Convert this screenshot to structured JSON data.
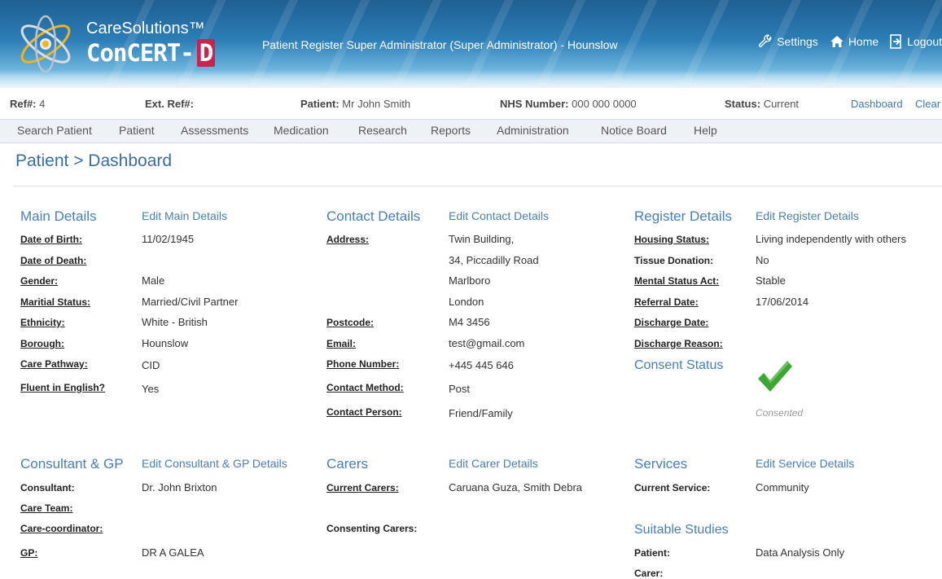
{
  "header": {
    "brand_top": "CareSolutions™",
    "brand_main": "ConCERT-",
    "brand_d": "D",
    "user_title": "Patient Register Super Administrator (Super Administrator) - Hounslow",
    "links": {
      "settings": "Settings",
      "home": "Home",
      "logout": "Logout"
    }
  },
  "infobar": {
    "ref_label": "Ref#:",
    "ref_value": "4",
    "ext_ref_label": "Ext. Ref#:",
    "patient_label": "Patient:",
    "patient_value": "Mr John Smith",
    "nhs_label": "NHS Number:",
    "nhs_value": "000 000 0000",
    "status_label": "Status:",
    "status_value": "Current",
    "dashboard_link": "Dashboard",
    "clear_link": "Clear"
  },
  "menu": [
    "Search Patient",
    "Patient",
    "Assessments",
    "Medication",
    "Research",
    "Reports",
    "Administration",
    "Notice Board",
    "Help"
  ],
  "breadcrumb": "Patient > Dashboard",
  "main_details": {
    "title": "Main Details",
    "edit": "Edit Main Details",
    "fields": [
      {
        "label": "Date of Birth:",
        "value": "11/02/1945"
      },
      {
        "label": "Date of Death:",
        "value": ""
      },
      {
        "label": "Gender:",
        "value": "Male"
      },
      {
        "label": "Maritial Status:",
        "value": "Married/Civil Partner"
      },
      {
        "label": "Ethnicity:",
        "value": "White - British"
      },
      {
        "label": "Borough:",
        "value": "Hounslow"
      },
      {
        "label": "Care Pathway:",
        "value": "CID"
      },
      {
        "label": "Fluent in English?",
        "value": "Yes"
      }
    ]
  },
  "contact_details": {
    "title": "Contact Details",
    "edit": "Edit Contact Details",
    "address_label": "Address:",
    "address_lines": [
      "Twin Building,",
      "34, Piccadilly Road",
      "Marlboro",
      "London"
    ],
    "fields": [
      {
        "label": "Postcode:",
        "value": "M4 3456"
      },
      {
        "label": "Email:",
        "value": "test@gmail.com"
      },
      {
        "label": "Phone Number:",
        "value": "+445 445 646"
      },
      {
        "label": "Contact Method:",
        "value": "Post"
      },
      {
        "label": "Contact Person:",
        "value": "Friend/Family"
      }
    ]
  },
  "register_details": {
    "title": "Register Details",
    "edit": "Edit Register Details",
    "fields": [
      {
        "label": "Housing Status:",
        "value": "Living independently with others"
      },
      {
        "label": "Tissue Donation:",
        "value": "No"
      },
      {
        "label": "Mental Status Act:",
        "value": "Stable"
      },
      {
        "label": "Referral Date:",
        "value": "17/06/2014"
      },
      {
        "label": "Discharge Date:",
        "value": ""
      },
      {
        "label": "Discharge Reason:",
        "value": ""
      }
    ],
    "consent_title": "Consent Status",
    "consent_text": "Consented",
    "consent_color": "#3fa535"
  },
  "consultant_gp": {
    "title": "Consultant & GP",
    "edit": "Edit Consultant & GP Details",
    "fields": [
      {
        "label": "Consultant:",
        "value": "Dr. John Brixton"
      },
      {
        "label": "Care Team:",
        "value": ""
      },
      {
        "label": "Care-coordinator:",
        "value": ""
      },
      {
        "label": "GP:",
        "value": "DR A GALEA"
      }
    ]
  },
  "carers": {
    "title": "Carers",
    "edit": "Edit Carer Details",
    "fields": [
      {
        "label": "Current Carers:",
        "value": "Caruana Guza, Smith Debra"
      },
      {
        "label": "Consenting Carers:",
        "value": ""
      }
    ]
  },
  "services": {
    "title": "Services",
    "edit": "Edit Service Details",
    "fields": [
      {
        "label": "Current Service:",
        "value": "Community"
      }
    ],
    "studies_title": "Suitable Studies",
    "studies": [
      {
        "label": "Patient:",
        "value": "Data Analysis Only"
      },
      {
        "label": "Carer:",
        "value": ""
      }
    ]
  }
}
